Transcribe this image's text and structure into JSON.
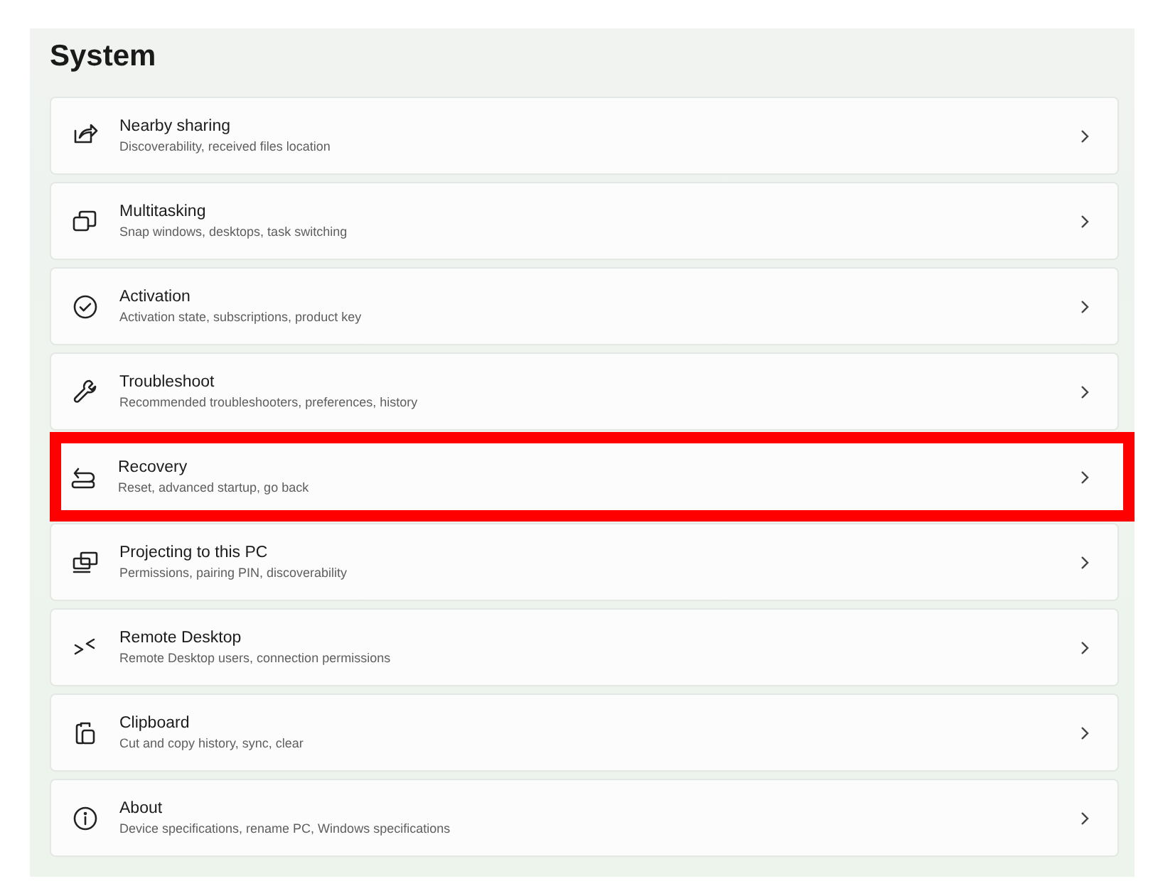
{
  "page": {
    "title": "System"
  },
  "items": [
    {
      "title": "Nearby sharing",
      "subtitle": "Discoverability, received files location",
      "highlighted": false
    },
    {
      "title": "Multitasking",
      "subtitle": "Snap windows, desktops, task switching",
      "highlighted": false
    },
    {
      "title": "Activation",
      "subtitle": "Activation state, subscriptions, product key",
      "highlighted": false
    },
    {
      "title": "Troubleshoot",
      "subtitle": "Recommended troubleshooters, preferences, history",
      "highlighted": false
    },
    {
      "title": "Recovery",
      "subtitle": "Reset, advanced startup, go back",
      "highlighted": true
    },
    {
      "title": "Projecting to this PC",
      "subtitle": "Permissions, pairing PIN, discoverability",
      "highlighted": false
    },
    {
      "title": "Remote Desktop",
      "subtitle": "Remote Desktop users, connection permissions",
      "highlighted": false
    },
    {
      "title": "Clipboard",
      "subtitle": "Cut and copy history, sync, clear",
      "highlighted": false
    },
    {
      "title": "About",
      "subtitle": "Device specifications, rename PC, Windows specifications",
      "highlighted": false
    }
  ]
}
